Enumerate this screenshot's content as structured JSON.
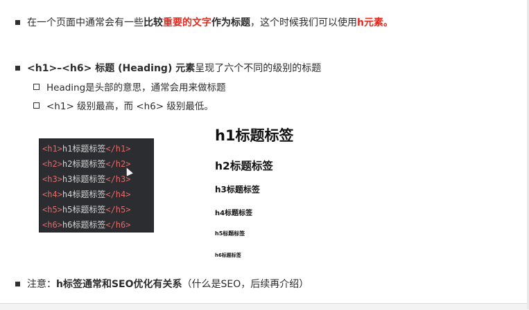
{
  "bullet1": {
    "pre": "在一个页面中通常会有一些",
    "strong1": "比较",
    "red1": "重要的文字",
    "strong2": "作为标题",
    "mid": "，这个时候我们可以使用",
    "red2": "h元素。"
  },
  "bullet2": {
    "strong": "<h1>–<h6> 标题 (Heading) 元素",
    "rest": "呈现了六个不同的级别的标题"
  },
  "sub1": "Heading是头部的意思，通常会用来做标题",
  "sub2": "<h1> 级别最高，而 <h6> 级别最低。",
  "code_lines": [
    {
      "open": "<h1>",
      "text": "h1标题标签",
      "close": "</h1>"
    },
    {
      "open": "<h2>",
      "text": "h2标题标签",
      "close": "</h2>"
    },
    {
      "open": "<h3>",
      "text": "h3标题标签",
      "close": "</h3>"
    },
    {
      "open": "<h4>",
      "text": "h4标题标签",
      "close": "</h4>"
    },
    {
      "open": "<h5>",
      "text": "h5标题标签",
      "close": "</h5>"
    },
    {
      "open": "<h6>",
      "text": "h6标题标签",
      "close": "</h6>"
    }
  ],
  "demo": {
    "h1": "h1标题标签",
    "h2": "h2标题标签",
    "h3": "h3标题标签",
    "h4": "h4标题标签",
    "h5": "h5标题标签",
    "h6": "h6标题标签"
  },
  "note": {
    "label": "注意：",
    "strong": "h标签通常和SEO优化有关系",
    "rest": "（什么是SEO，后续再介绍）"
  },
  "colors": {
    "accent_red": "#e02b1f",
    "code_bg": "#2b2d30",
    "code_tag": "#e06b6b"
  }
}
